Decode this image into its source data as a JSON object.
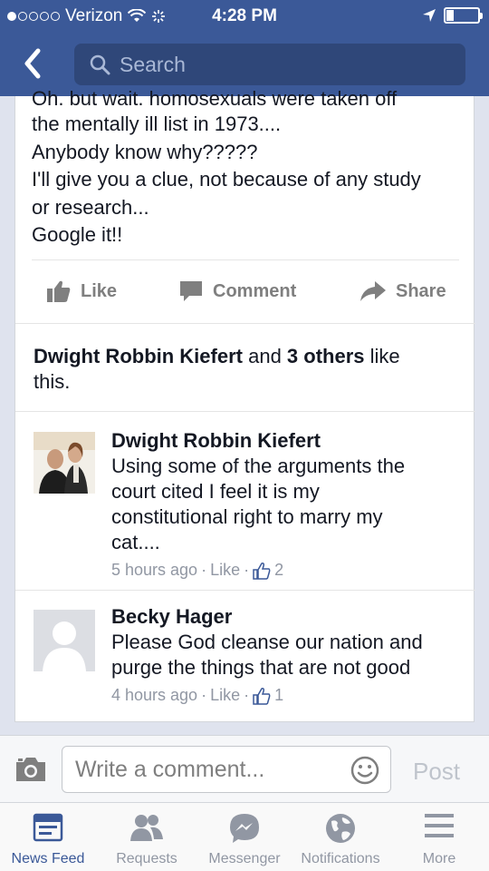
{
  "status_bar": {
    "carrier": "Verizon",
    "time": "4:28 PM"
  },
  "header": {
    "search_placeholder": "Search"
  },
  "post": {
    "cut_line": "Oh, but wait, homosexuals were taken off",
    "lines": [
      "the mentally ill list in 1973....",
      "Anybody know why?????",
      "I'll give you a clue, not because of any study",
      "or research...",
      "Google it!!"
    ]
  },
  "actions": {
    "like": "Like",
    "comment": "Comment",
    "share": "Share"
  },
  "likes_summary": {
    "name": "Dwight Robbin Kiefert",
    "and": " and ",
    "others": "3 others",
    "suffix": " like",
    "suffix2": "this."
  },
  "comments": [
    {
      "name": "Dwight Robbin Kiefert",
      "lines": [
        "Using some of the arguments the",
        "court cited I feel it is my",
        "constitutional right to marry my",
        "cat...."
      ],
      "time": "5 hours ago",
      "like": "Like",
      "dot": "·",
      "count": "2"
    },
    {
      "name": "Becky Hager",
      "lines": [
        "Please God cleanse our nation and",
        "purge the things that are not good"
      ],
      "time": "4 hours ago",
      "like": "Like",
      "dot": "·",
      "count": "1"
    }
  ],
  "composer": {
    "placeholder": "Write a comment...",
    "post": "Post"
  },
  "tabs": [
    {
      "label": "News Feed",
      "icon": "news-feed-icon"
    },
    {
      "label": "Requests",
      "icon": "requests-icon"
    },
    {
      "label": "Messenger",
      "icon": "messenger-icon"
    },
    {
      "label": "Notifications",
      "icon": "notifications-icon"
    },
    {
      "label": "More",
      "icon": "more-icon"
    }
  ],
  "colors": {
    "brand": "#3b5998",
    "muted": "#9197a3"
  }
}
